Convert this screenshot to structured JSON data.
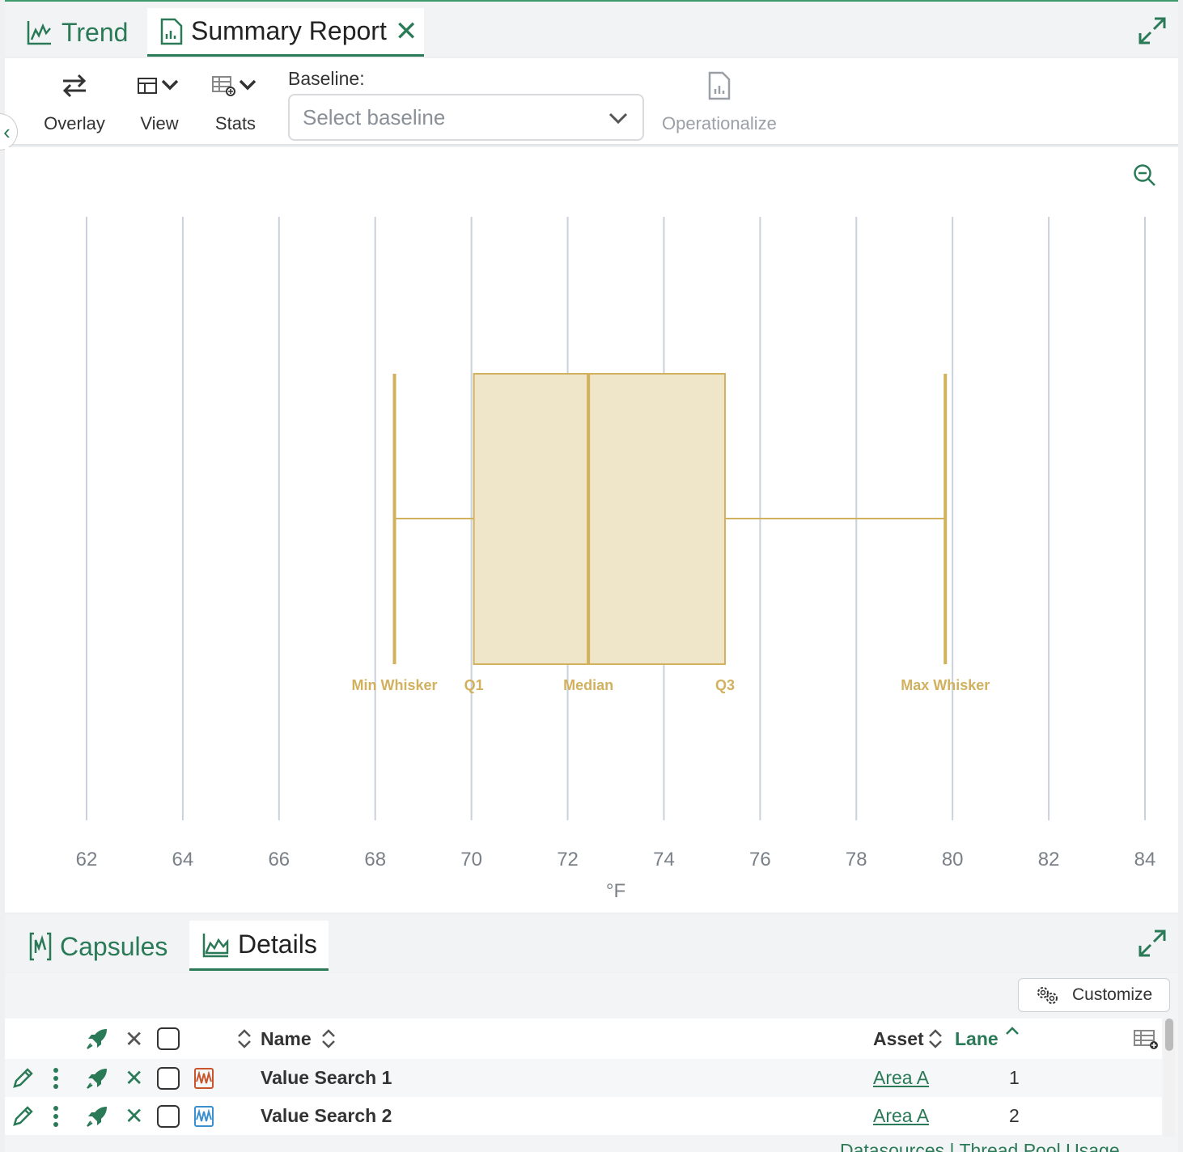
{
  "top_tabs": {
    "trend_label": "Trend",
    "summary_label": "Summary Report",
    "close_glyph": "✕"
  },
  "toolbar": {
    "overlay_label": "Overlay",
    "view_label": "View",
    "stats_label": "Stats",
    "baseline_label": "Baseline:",
    "baseline_placeholder": "Select baseline",
    "operationalize_label": "Operationalize"
  },
  "chart_data": {
    "type": "boxplot",
    "xlabel": "°F",
    "xlim": [
      61.5,
      84.5
    ],
    "xticks": [
      62,
      64,
      66,
      68,
      70,
      72,
      74,
      76,
      78,
      80,
      82,
      84
    ],
    "grid": true,
    "color": "#d2b15e",
    "fill": "#efe5c8",
    "series": [
      {
        "min_whisker": 68.4,
        "q1": 70.05,
        "median": 72.43,
        "q3": 75.27,
        "max_whisker": 79.85
      }
    ],
    "annotations": {
      "min_whisker": "Min Whisker",
      "q1": "Q1",
      "median": "Median",
      "q3": "Q3",
      "max_whisker": "Max Whisker"
    }
  },
  "bottom_tabs": {
    "capsules_label": "Capsules",
    "details_label": "Details"
  },
  "details": {
    "customize_label": "Customize",
    "columns": {
      "name": "Name",
      "asset": "Asset",
      "lane": "Lane"
    },
    "rows": [
      {
        "name": "Value Search 1",
        "asset": "Area A",
        "lane": "1",
        "color": "#c8552b"
      },
      {
        "name": "Value Search 2",
        "asset": "Area A",
        "lane": "2",
        "color": "#3a8fd0"
      }
    ],
    "footer": "Datasources | Thread Pool Usage"
  },
  "colors": {
    "accent": "#2a7a57",
    "grid": "#c9d2dc",
    "tick_text": "#7a8088"
  }
}
